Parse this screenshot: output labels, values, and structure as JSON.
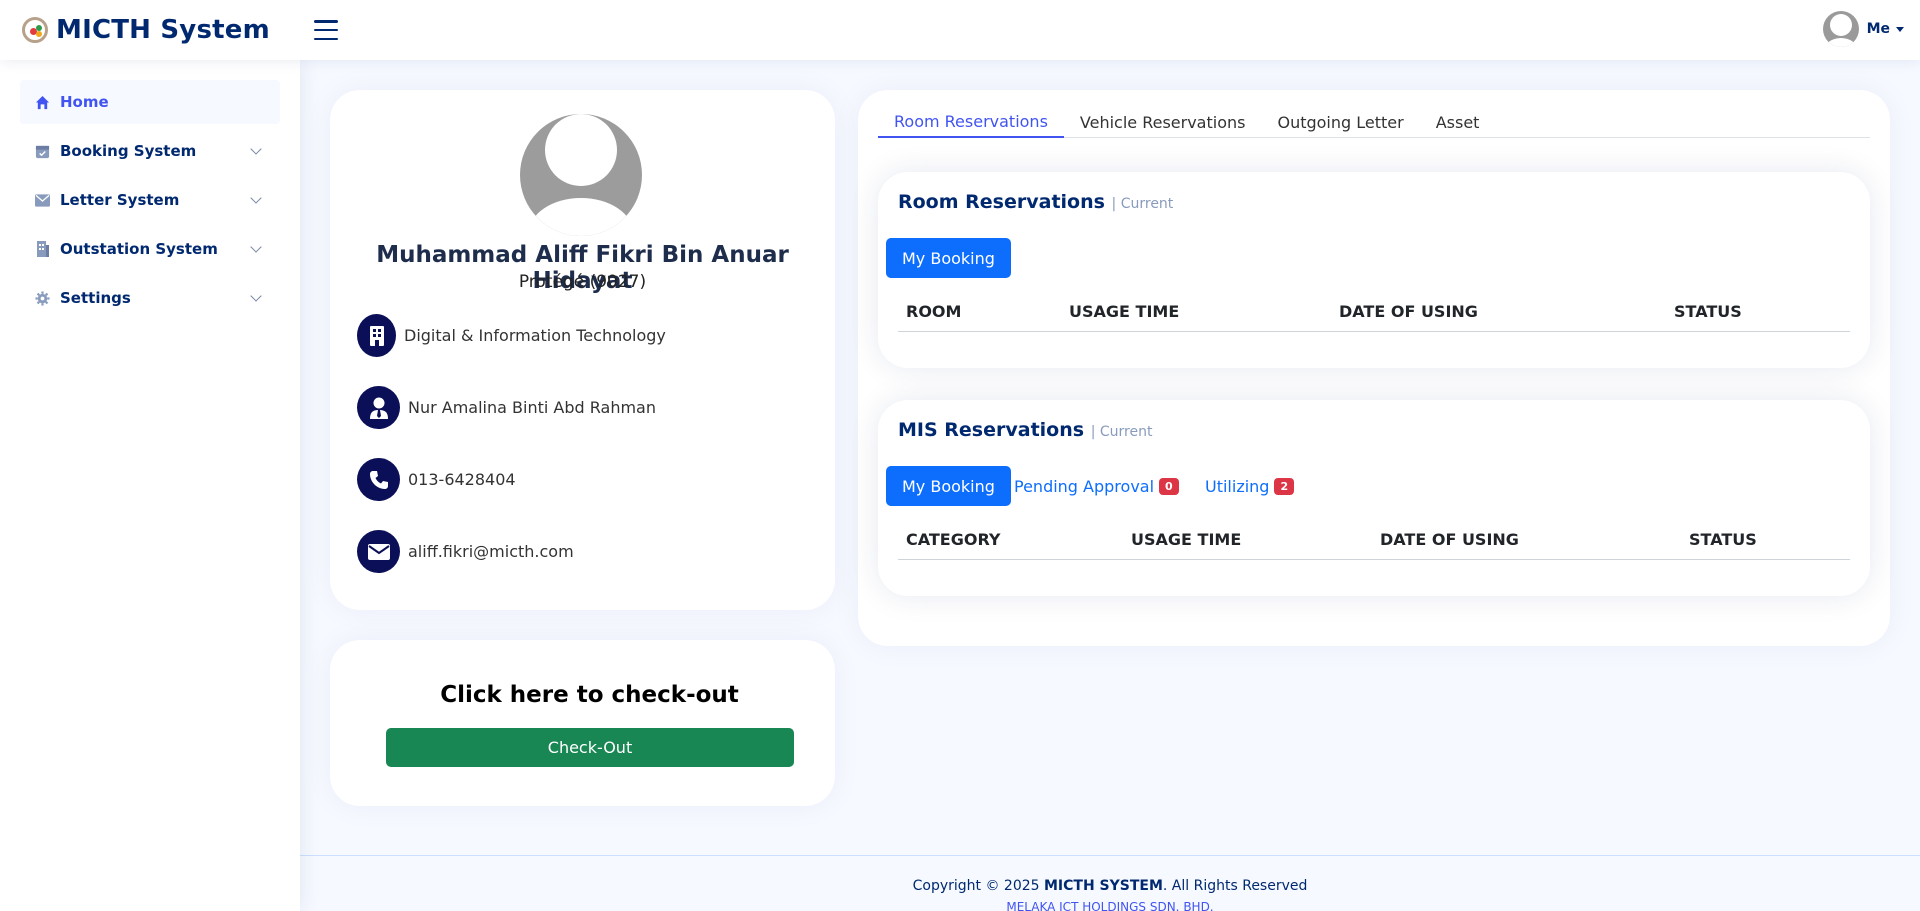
{
  "app": {
    "title": "MICTH System"
  },
  "header": {
    "user_label": "Me"
  },
  "sidebar": {
    "items": [
      {
        "label": "Home",
        "icon": "house-icon"
      },
      {
        "label": "Booking System",
        "icon": "calendar-check-icon"
      },
      {
        "label": "Letter System",
        "icon": "envelope-icon"
      },
      {
        "label": "Outstation System",
        "icon": "building-icon"
      },
      {
        "label": "Settings",
        "icon": "gear-icon"
      }
    ]
  },
  "profile": {
    "name": "Muhammad Aliff Fikri Bin Anuar Hidayat",
    "role": "Protégé (9027)",
    "department": "Digital & Information Technology",
    "supervisor": "Nur Amalina Binti Abd Rahman",
    "phone": "013-6428404",
    "email": "aliff.fikri@micth.com"
  },
  "checkout": {
    "title": "Click here to check-out",
    "button": "Check-Out"
  },
  "tabs": [
    "Room Reservations",
    "Vehicle Reservations",
    "Outgoing Letter",
    "Asset"
  ],
  "room_reservations": {
    "title": "Room Reservations",
    "subtitle": "| Current",
    "button": "My Booking",
    "columns": [
      "ROOM",
      "USAGE TIME",
      "DATE OF USING",
      "STATUS"
    ]
  },
  "mis_reservations": {
    "title": "MIS Reservations",
    "subtitle": "| Current",
    "button": "My Booking",
    "pending_label": "Pending Approval",
    "pending_count": "0",
    "utilizing_label": "Utilizing",
    "utilizing_count": "2",
    "columns": [
      "CATEGORY",
      "USAGE TIME",
      "DATE OF USING",
      "STATUS"
    ]
  },
  "footer": {
    "copyright_prefix": "Copyright © 2025 ",
    "brand": "MICTH SYSTEM",
    "copyright_suffix": ". All Rights Reserved",
    "company": "MELAKA ICT HOLDINGS SDN. BHD."
  },
  "colors": {
    "primary": "#0d6efd",
    "accent": "#4154f1",
    "navy": "#012970",
    "success": "#198754",
    "danger": "#dc3545"
  }
}
